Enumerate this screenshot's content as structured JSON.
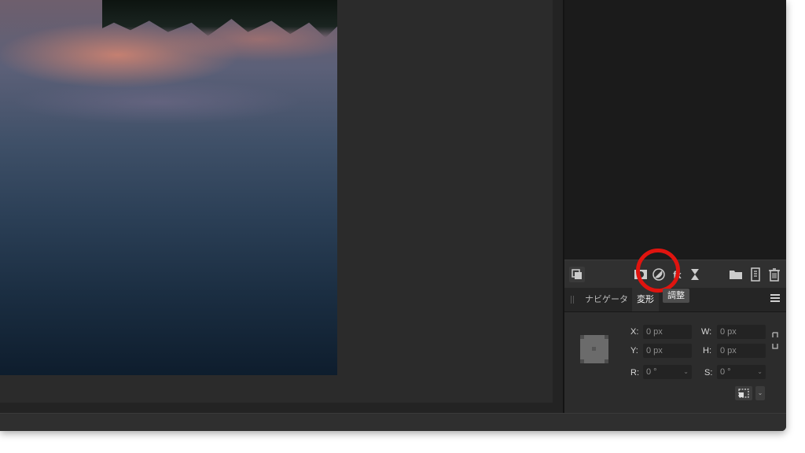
{
  "tabs": {
    "navigator": "ナビゲータ",
    "transform": "変形",
    "tooltip": "調整"
  },
  "transform": {
    "x_label": "X:",
    "x_value": "0 px",
    "y_label": "Y:",
    "y_value": "0 px",
    "w_label": "W:",
    "w_value": "0 px",
    "h_label": "H:",
    "h_value": "0 px",
    "r_label": "R:",
    "r_value": "0 °",
    "s_label": "S:",
    "s_value": "0 °"
  },
  "toolbar_icons": [
    "layers-arrange-icon",
    "mask-icon",
    "adjustment-icon",
    "fx-icon",
    "live-filter-icon",
    "folder-icon",
    "add-pixel-layer-icon",
    "trash-icon"
  ],
  "colors": {
    "highlight": "#e0140f",
    "panel_bg": "#2c2c2c"
  }
}
